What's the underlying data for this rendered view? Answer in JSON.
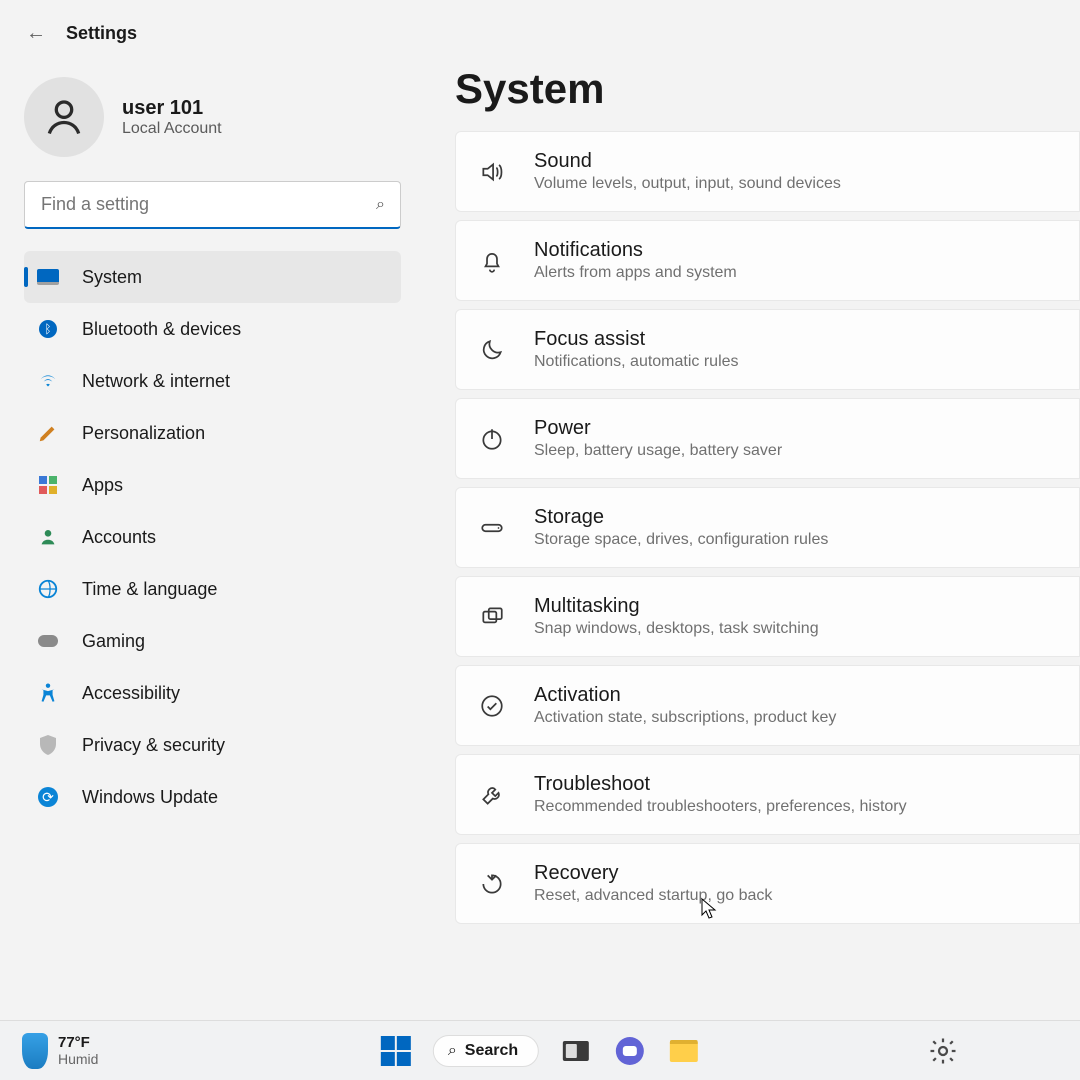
{
  "header": {
    "title": "Settings"
  },
  "user": {
    "name": "user 101",
    "sub": "Local Account"
  },
  "search": {
    "placeholder": "Find a setting"
  },
  "nav": [
    {
      "id": "system",
      "label": "System",
      "active": true
    },
    {
      "id": "bluetooth",
      "label": "Bluetooth & devices"
    },
    {
      "id": "network",
      "label": "Network & internet"
    },
    {
      "id": "personalization",
      "label": "Personalization"
    },
    {
      "id": "apps",
      "label": "Apps"
    },
    {
      "id": "accounts",
      "label": "Accounts"
    },
    {
      "id": "time",
      "label": "Time & language"
    },
    {
      "id": "gaming",
      "label": "Gaming"
    },
    {
      "id": "accessibility",
      "label": "Accessibility"
    },
    {
      "id": "privacy",
      "label": "Privacy & security"
    },
    {
      "id": "update",
      "label": "Windows Update"
    }
  ],
  "page": {
    "title": "System"
  },
  "cards": [
    {
      "id": "sound",
      "title": "Sound",
      "sub": "Volume levels, output, input, sound devices"
    },
    {
      "id": "notifications",
      "title": "Notifications",
      "sub": "Alerts from apps and system"
    },
    {
      "id": "focus",
      "title": "Focus assist",
      "sub": "Notifications, automatic rules"
    },
    {
      "id": "power",
      "title": "Power",
      "sub": "Sleep, battery usage, battery saver"
    },
    {
      "id": "storage",
      "title": "Storage",
      "sub": "Storage space, drives, configuration rules"
    },
    {
      "id": "multitasking",
      "title": "Multitasking",
      "sub": "Snap windows, desktops, task switching"
    },
    {
      "id": "activation",
      "title": "Activation",
      "sub": "Activation state, subscriptions, product key"
    },
    {
      "id": "troubleshoot",
      "title": "Troubleshoot",
      "sub": "Recommended troubleshooters, preferences, history"
    },
    {
      "id": "recovery",
      "title": "Recovery",
      "sub": "Reset, advanced startup, go back"
    }
  ],
  "taskbar": {
    "weather": {
      "temp": "77°F",
      "cond": "Humid"
    },
    "search": "Search"
  }
}
